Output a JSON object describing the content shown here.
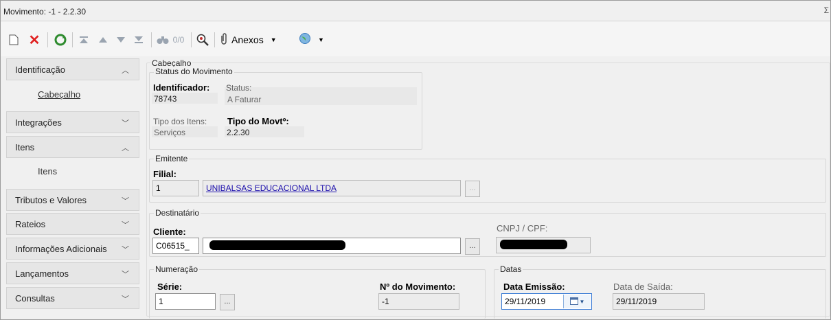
{
  "window": {
    "title": "Movimento: -1 - 2.2.30",
    "corner": "Σ"
  },
  "toolbar": {
    "counter": "0/0",
    "anexos_label": "Anexos"
  },
  "sidebar": {
    "groups": [
      {
        "label": "Identificação",
        "expanded": true,
        "sub": [
          "Cabeçalho"
        ]
      },
      {
        "label": "Integrações",
        "expanded": false,
        "sub": []
      },
      {
        "label": "Itens",
        "expanded": true,
        "sub": [
          "Itens"
        ]
      },
      {
        "label": "Tributos e Valores",
        "expanded": false,
        "sub": []
      },
      {
        "label": "Rateios",
        "expanded": false,
        "sub": []
      },
      {
        "label": "Informações Adicionais",
        "expanded": false,
        "sub": []
      },
      {
        "label": "Lançamentos",
        "expanded": false,
        "sub": []
      },
      {
        "label": "Consultas",
        "expanded": false,
        "sub": []
      }
    ]
  },
  "cabecalho": {
    "title": "Cabeçalho",
    "status_section": {
      "legend": "Status do Movimento",
      "identificador_label": "Identificador:",
      "identificador_value": "78743",
      "status_label": "Status:",
      "status_value": "A Faturar",
      "tipo_itens_label": "Tipo dos Itens:",
      "tipo_itens_value": "Serviços",
      "tipo_movto_label": "Tipo do Movtº:",
      "tipo_movto_value": "2.2.30"
    },
    "emitente": {
      "legend": "Emitente",
      "filial_label": "Filial:",
      "filial_code": "1",
      "filial_name": "UNIBALSAS EDUCACIONAL LTDA",
      "dots": "..."
    },
    "destinatario": {
      "legend": "Destinatário",
      "cliente_label": "Cliente:",
      "cliente_code": "C06515_",
      "cnpj_label": "CNPJ / CPF:",
      "dots": "..."
    },
    "numeracao": {
      "legend": "Numeração",
      "serie_label": "Série:",
      "serie_value": "1",
      "numero_label": "Nº do Movimento:",
      "numero_value": "-1",
      "dots": "..."
    },
    "datas": {
      "legend": "Datas",
      "emissao_label": "Data Emissão:",
      "emissao_value": "29/11/2019",
      "saida_label": "Data de Saída:",
      "saida_value": "29/11/2019"
    }
  },
  "colors": {
    "link": "#1a0dab",
    "toolbar_green": "#2e8b2e",
    "toolbar_red": "#e02020"
  }
}
